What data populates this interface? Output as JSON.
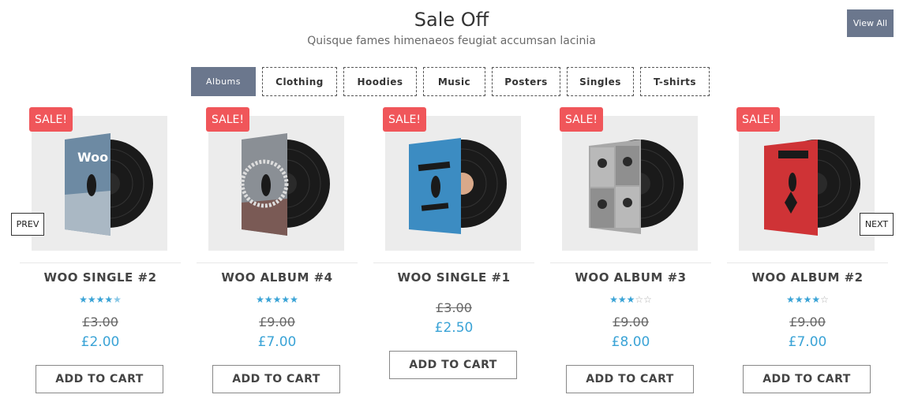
{
  "header": {
    "title": "Sale Off",
    "subtitle": "Quisque fames himenaeos feugiat accumsan lacinia",
    "view_all": "View All"
  },
  "tabs": [
    {
      "label": "Albums",
      "active": true
    },
    {
      "label": "Clothing",
      "active": false
    },
    {
      "label": "Hoodies",
      "active": false
    },
    {
      "label": "Music",
      "active": false
    },
    {
      "label": "Posters",
      "active": false
    },
    {
      "label": "Singles",
      "active": false
    },
    {
      "label": "T-shirts",
      "active": false
    }
  ],
  "nav": {
    "prev": "PREV",
    "next": "NEXT"
  },
  "products": [
    {
      "badge": "SALE!",
      "name": "WOO SINGLE #2",
      "rating": 4.5,
      "old_price": "£3.00",
      "price": "£2.00",
      "cart": "ADD TO CART"
    },
    {
      "badge": "SALE!",
      "name": "WOO ALBUM #4",
      "rating": 5,
      "old_price": "£9.00",
      "price": "£7.00",
      "cart": "ADD TO CART"
    },
    {
      "badge": "SALE!",
      "name": "WOO SINGLE #1",
      "rating": null,
      "old_price": "£3.00",
      "price": "£2.50",
      "cart": "ADD TO CART"
    },
    {
      "badge": "SALE!",
      "name": "WOO ALBUM #3",
      "rating": 3,
      "old_price": "£9.00",
      "price": "£8.00",
      "cart": "ADD TO CART"
    },
    {
      "badge": "SALE!",
      "name": "WOO ALBUM #2",
      "rating": 4,
      "old_price": "£9.00",
      "price": "£7.00",
      "cart": "ADD TO CART"
    }
  ],
  "colors": {
    "accent": "#6b778d",
    "sale": "#f0565a",
    "price": "#3aa3d6",
    "star": "#3aa3d6"
  }
}
